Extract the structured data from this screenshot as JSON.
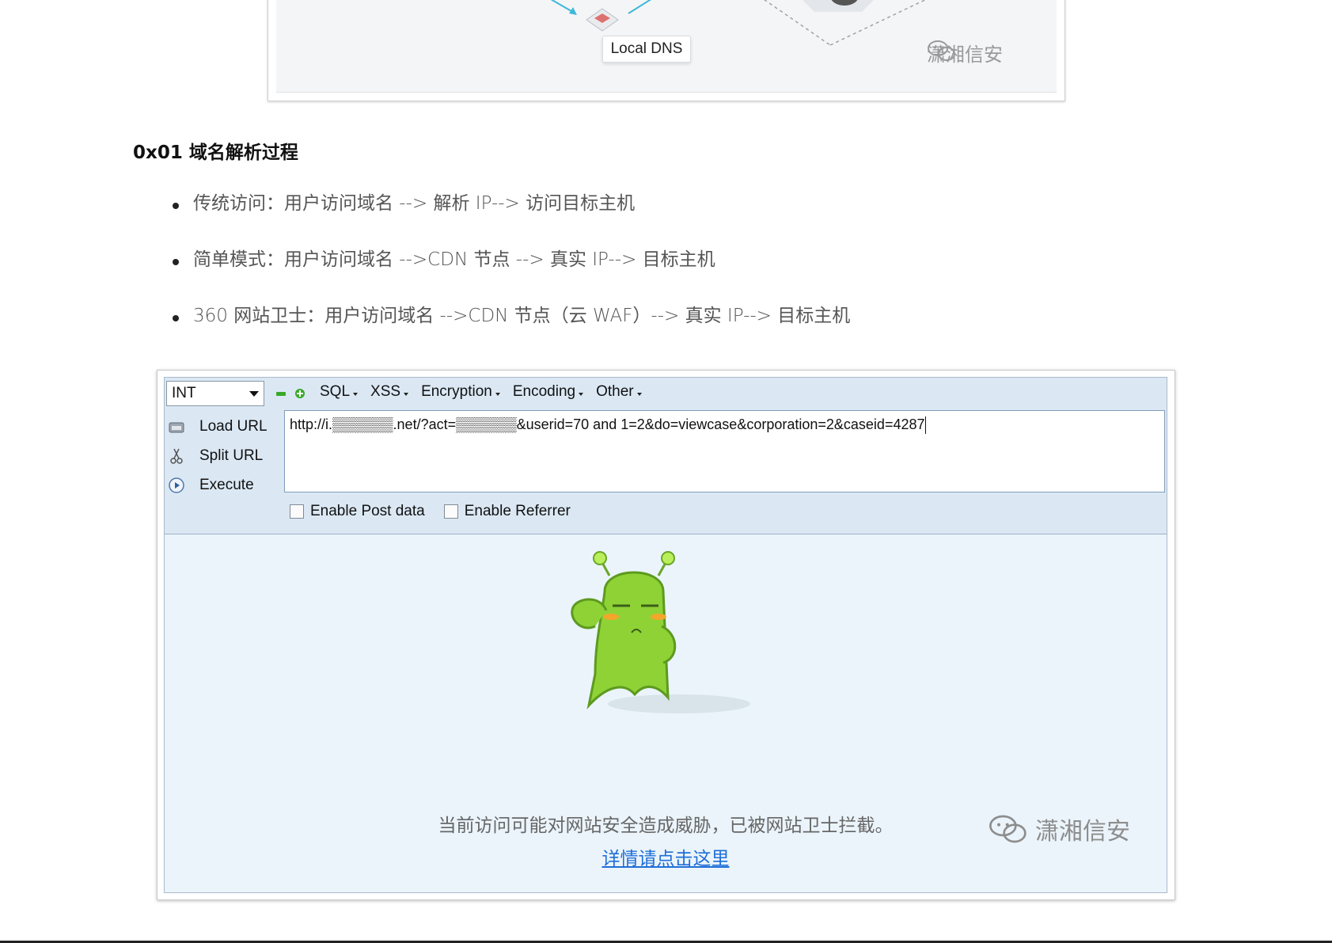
{
  "top_figure": {
    "dns_label": "Local DNS",
    "watermark": "潇湘信安"
  },
  "section": {
    "heading": "0x01 域名解析过程",
    "items": [
      "传统访问：用户访问域名 --> 解析 IP--> 访问目标主机",
      "简单模式：用户访问域名 -->CDN 节点 --> 真实 IP--> 目标主机",
      "360 网站卫士：用户访问域名 -->CDN 节点（云 WAF）--> 真实 IP--> 目标主机"
    ]
  },
  "hackbar": {
    "select_value": "INT",
    "menus": [
      "SQL",
      "XSS",
      "Encryption",
      "Encoding",
      "Other"
    ],
    "buttons": {
      "load_url": "Load URL",
      "split_url": "Split URL",
      "execute": "Execute"
    },
    "url_value": "http://i.▒▒▒▒▒▒.net/?act=▒▒▒▒▒▒&userid=70 and 1=2&do=viewcase&corporation=2&caseid=4287",
    "checkboxes": {
      "post_data": "Enable Post data",
      "referrer": "Enable Referrer"
    }
  },
  "block_page": {
    "message": "当前访问可能对网站安全造成威胁，已被网站卫士拦截。",
    "detail_link": "详情请点击这里",
    "watermark": "潇湘信安"
  },
  "colors": {
    "hackbar_bg": "#dbe8f4",
    "content_bg": "#ebf4fb",
    "link": "#1f6fd8",
    "mascot_green": "#8ed236"
  }
}
